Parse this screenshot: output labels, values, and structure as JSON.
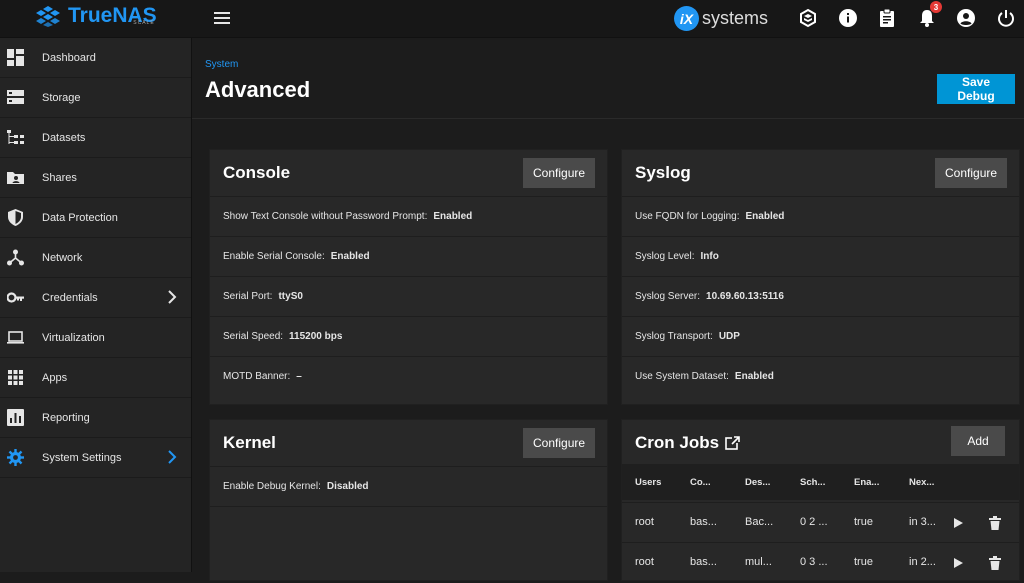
{
  "header": {
    "brand": "TrueNAS",
    "brand_sub": "SCALE",
    "partner": "systems",
    "partner_mark": "iX",
    "notifications_count": "3"
  },
  "sidebar": {
    "items": [
      {
        "label": "Dashboard",
        "icon": "dashboard-icon"
      },
      {
        "label": "Storage",
        "icon": "storage-icon"
      },
      {
        "label": "Datasets",
        "icon": "datasets-icon"
      },
      {
        "label": "Shares",
        "icon": "shares-icon"
      },
      {
        "label": "Data Protection",
        "icon": "shield-icon"
      },
      {
        "label": "Network",
        "icon": "network-icon"
      },
      {
        "label": "Credentials",
        "icon": "key-icon"
      },
      {
        "label": "Virtualization",
        "icon": "laptop-icon"
      },
      {
        "label": "Apps",
        "icon": "apps-grid-icon"
      },
      {
        "label": "Reporting",
        "icon": "chart-icon"
      },
      {
        "label": "System Settings",
        "icon": "gear-icon"
      }
    ]
  },
  "page": {
    "breadcrumb": "System",
    "title": "Advanced",
    "save_debug": "Save Debug"
  },
  "console": {
    "title": "Console",
    "configure": "Configure",
    "rows": [
      {
        "k": "Show Text Console without Password Prompt:",
        "v": "Enabled"
      },
      {
        "k": "Enable Serial Console:",
        "v": "Enabled"
      },
      {
        "k": "Serial Port:",
        "v": "ttyS0"
      },
      {
        "k": "Serial Speed:",
        "v": "115200 bps"
      },
      {
        "k": "MOTD Banner:",
        "v": "–"
      }
    ]
  },
  "syslog": {
    "title": "Syslog",
    "configure": "Configure",
    "rows": [
      {
        "k": "Use FQDN for Logging:",
        "v": "Enabled"
      },
      {
        "k": "Syslog Level:",
        "v": "Info"
      },
      {
        "k": "Syslog Server:",
        "v": "10.69.60.13:5116"
      },
      {
        "k": "Syslog Transport:",
        "v": "UDP"
      },
      {
        "k": "Use System Dataset:",
        "v": "Enabled"
      }
    ]
  },
  "kernel": {
    "title": "Kernel",
    "configure": "Configure",
    "rows": [
      {
        "k": "Enable Debug Kernel:",
        "v": "Disabled"
      }
    ]
  },
  "cron": {
    "title": "Cron Jobs",
    "add": "Add",
    "columns": [
      "Users",
      "Co...",
      "Des...",
      "Sch...",
      "Ena...",
      "Nex..."
    ],
    "rows": [
      [
        "root",
        "bas...",
        "Bac...",
        "0 2 ...",
        "true",
        "in 3..."
      ],
      [
        "root",
        "bas...",
        "mul...",
        "0 3 ...",
        "true",
        "in 2..."
      ]
    ]
  },
  "colors": {
    "accent": "#2196f3",
    "primary_button": "#0095d5",
    "badge": "#e53935",
    "card": "#282828",
    "sidebar": "#242424"
  }
}
